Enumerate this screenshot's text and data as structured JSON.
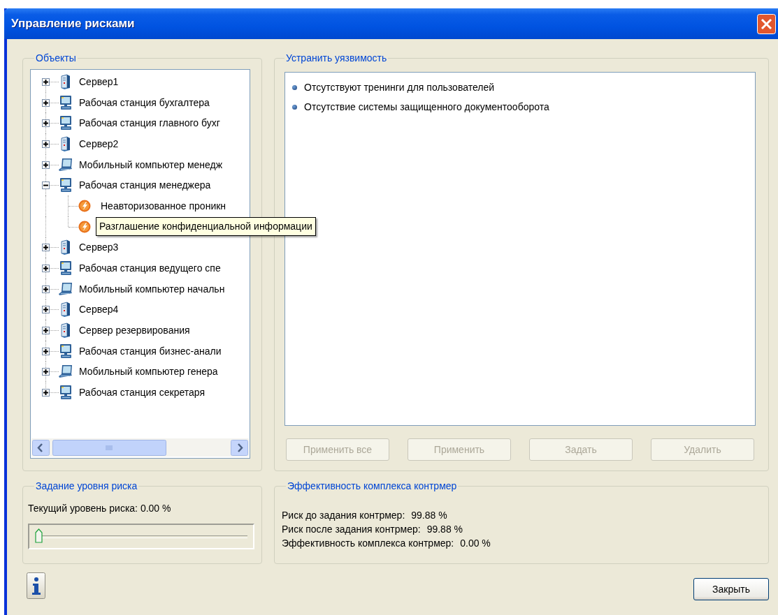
{
  "window": {
    "title": "Управление рисками"
  },
  "objects": {
    "title": "Объекты",
    "tree": [
      {
        "label": "Сервер1",
        "kind": "server",
        "expanded": false
      },
      {
        "label": "Рабочая станция бухгалтера",
        "kind": "workstation",
        "expanded": false
      },
      {
        "label": "Рабочая станция главного бухг",
        "kind": "workstation",
        "expanded": false
      },
      {
        "label": "Сервер2",
        "kind": "server",
        "expanded": false
      },
      {
        "label": "Мобильный компьютер менедж",
        "kind": "laptop",
        "expanded": false
      },
      {
        "label": "Рабочая станция менеджера",
        "kind": "workstation",
        "expanded": true,
        "children": [
          {
            "label": "Неавторизованное проникн",
            "kind": "threat"
          },
          {
            "kind": "threat",
            "tooltip": "Разглашение конфиденциальной информации"
          }
        ]
      },
      {
        "label": "Сервер3",
        "kind": "server",
        "expanded": false
      },
      {
        "label": "Рабочая станция ведущего спе",
        "kind": "workstation",
        "expanded": false
      },
      {
        "label": "Мобильный компьютер начальн",
        "kind": "laptop",
        "expanded": false
      },
      {
        "label": "Сервер4",
        "kind": "server",
        "expanded": false
      },
      {
        "label": "Сервер резервирования",
        "kind": "server",
        "expanded": false
      },
      {
        "label": "Рабочая станция бизнес-анали",
        "kind": "workstation",
        "expanded": false
      },
      {
        "label": "Мобильный компьютер генера",
        "kind": "laptop",
        "expanded": false
      },
      {
        "label": "Рабочая станция секретаря",
        "kind": "workstation",
        "expanded": false
      }
    ]
  },
  "vulnerabilities": {
    "title": "Устранить уязвимость",
    "items": [
      "Отсутствуют тренинги для пользователей",
      "Отсутствие системы защищенного документооборота"
    ],
    "buttons": [
      {
        "label": "Применить все",
        "disabled": true
      },
      {
        "label": "Применить",
        "disabled": true
      },
      {
        "label": "Задать",
        "disabled": true
      },
      {
        "label": "Удалить",
        "disabled": true
      }
    ]
  },
  "risk_level": {
    "title": "Задание уровня риска",
    "current": "Текущий уровень риска: 0.00 %",
    "slider": {
      "level": 0
    }
  },
  "effectiveness": {
    "title": "Эффективность комплекса контрмер",
    "rows": [
      {
        "label": "Риск до задания контрмер:",
        "value": "99.88 %"
      },
      {
        "label": "Риск после задания контрмер:",
        "value": "99.88 %"
      },
      {
        "label": "Эффективность комплекса контрмер:",
        "value": "0.00 %"
      }
    ]
  },
  "close_button": "Закрыть"
}
